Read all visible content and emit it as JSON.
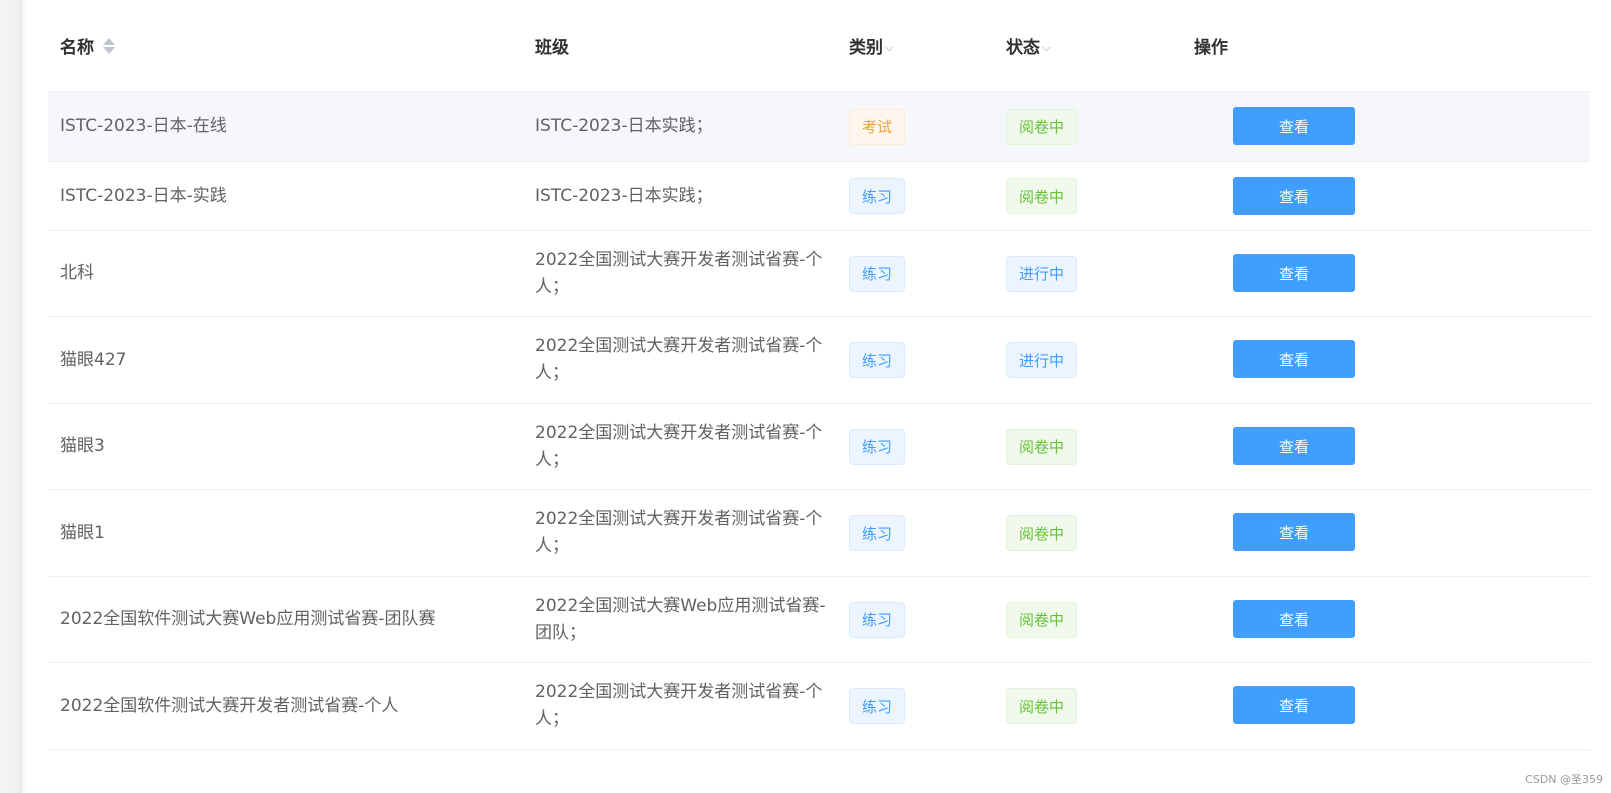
{
  "table": {
    "headers": {
      "name": "名称",
      "class": "班级",
      "category": "类别",
      "status": "状态",
      "operation": "操作"
    },
    "filter_glyph": "⌵",
    "rows": [
      {
        "name": "ISTC-2023-日本-在线",
        "class": "ISTC-2023-日本实践；",
        "category": "考试",
        "category_type": "warning",
        "status": "阅卷中",
        "status_type": "success",
        "action": "查看",
        "highlighted": true
      },
      {
        "name": "ISTC-2023-日本-实践",
        "class": "ISTC-2023-日本实践；",
        "category": "练习",
        "category_type": "info-blue",
        "status": "阅卷中",
        "status_type": "success",
        "action": "查看"
      },
      {
        "name": "北科",
        "class": "2022全国测试大赛开发者测试省赛-个人；",
        "category": "练习",
        "category_type": "info-blue",
        "status": "进行中",
        "status_type": "info-blue",
        "action": "查看"
      },
      {
        "name": "猫眼427",
        "class": "2022全国测试大赛开发者测试省赛-个人；",
        "category": "练习",
        "category_type": "info-blue",
        "status": "进行中",
        "status_type": "info-blue",
        "action": "查看"
      },
      {
        "name": "猫眼3",
        "class": "2022全国测试大赛开发者测试省赛-个人；",
        "category": "练习",
        "category_type": "info-blue",
        "status": "阅卷中",
        "status_type": "success",
        "action": "查看"
      },
      {
        "name": "猫眼1",
        "class": "2022全国测试大赛开发者测试省赛-个人；",
        "category": "练习",
        "category_type": "info-blue",
        "status": "阅卷中",
        "status_type": "success",
        "action": "查看"
      },
      {
        "name": "2022全国软件测试大赛Web应用测试省赛-团队赛",
        "class": "2022全国测试大赛Web应用测试省赛-团队；",
        "category": "练习",
        "category_type": "info-blue",
        "status": "阅卷中",
        "status_type": "success",
        "action": "查看"
      },
      {
        "name": "2022全国软件测试大赛开发者测试省赛-个人",
        "class": "2022全国测试大赛开发者测试省赛-个人；",
        "category": "练习",
        "category_type": "info-blue",
        "status": "阅卷中",
        "status_type": "success",
        "action": "查看"
      }
    ]
  },
  "watermark": "CSDN @圣359",
  "colors": {
    "primary": "#409eff",
    "warning_tag": "#e6a23c",
    "success_tag": "#67c23a",
    "row_highlight": "#f5f7fa"
  }
}
